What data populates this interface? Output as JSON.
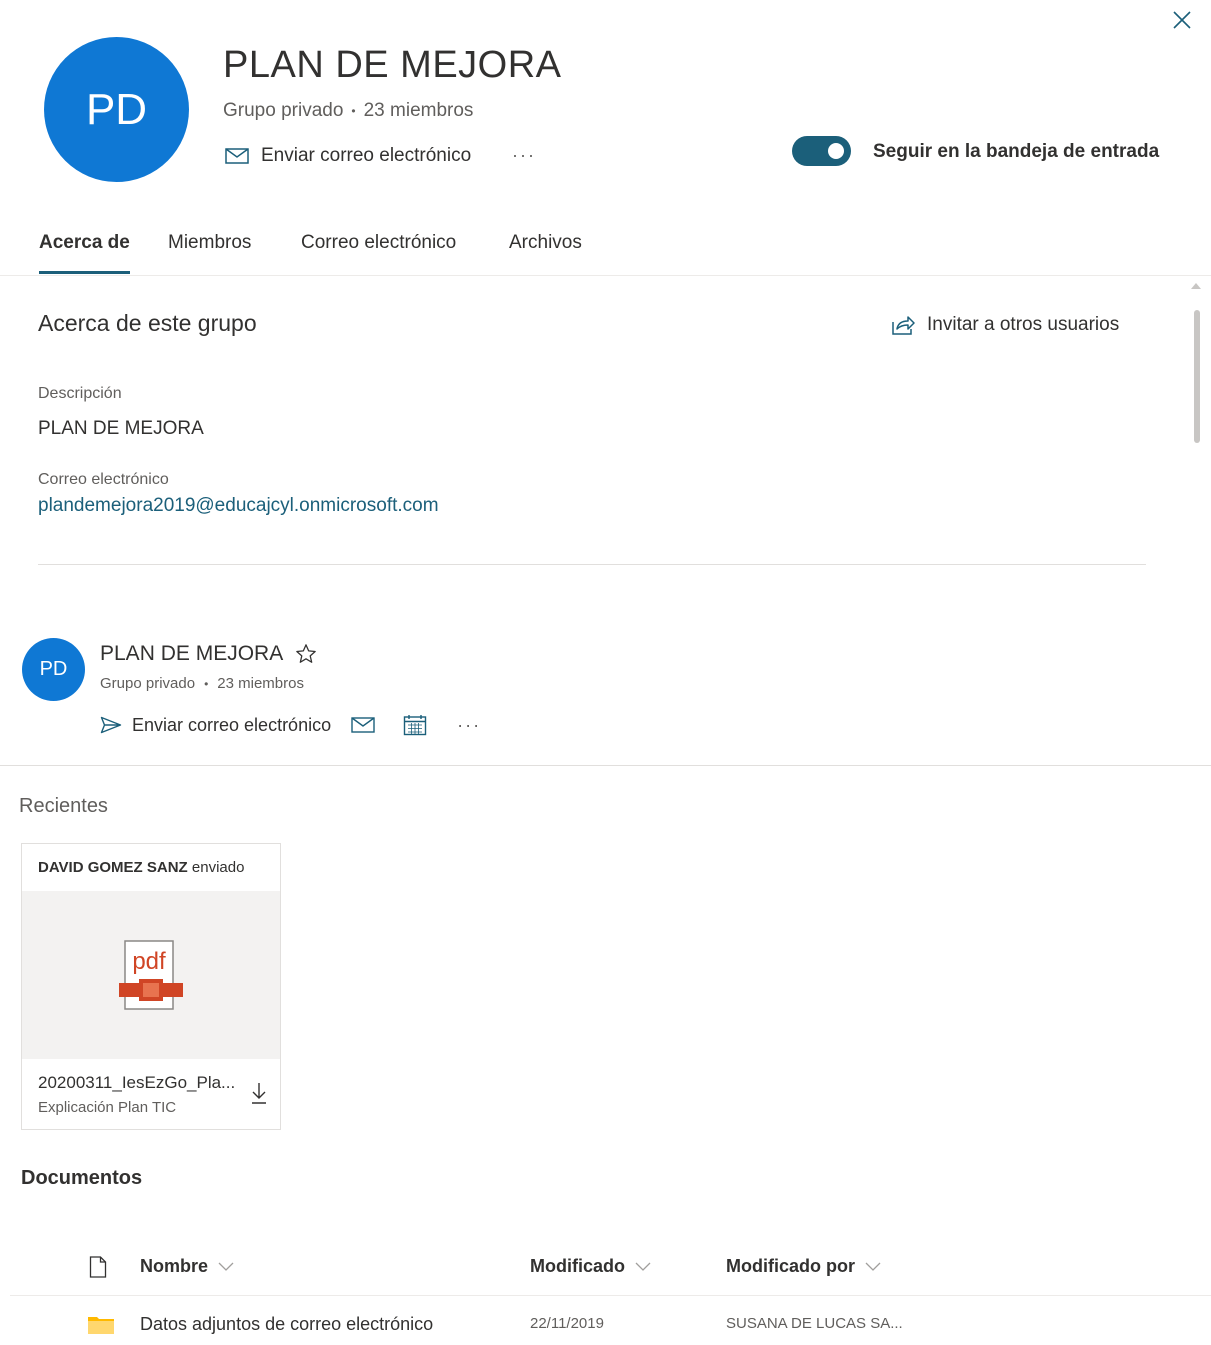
{
  "header": {
    "close_icon": "close-icon",
    "avatar_initials": "PD",
    "avatar_color": "#0f78d4",
    "title": "PLAN DE MEJORA",
    "type": "Grupo privado",
    "separator": "•",
    "members": "23 miembros",
    "send_email": "Enviar correo electrónico",
    "more": "···",
    "follow_label": "Seguir en la bandeja de entrada",
    "follow_on": true,
    "accent": "#1b5f7a"
  },
  "tabs": [
    {
      "label": "Acerca de",
      "active": true
    },
    {
      "label": "Miembros",
      "active": false
    },
    {
      "label": "Correo electrónico",
      "active": false
    },
    {
      "label": "Archivos",
      "active": false
    }
  ],
  "about": {
    "title": "Acerca de este grupo",
    "invite": "Invitar a otros usuarios",
    "description_label": "Descripción",
    "description": "PLAN DE MEJORA",
    "email_label": "Correo electrónico",
    "email": "plandemejora2019@educajcyl.onmicrosoft.com"
  },
  "group_card": {
    "initials": "PD",
    "title": "PLAN DE MEJORA",
    "type": "Grupo privado",
    "separator": "•",
    "members": "23 miembros",
    "send_email": "Enviar correo electrónico",
    "more": "···"
  },
  "recent": {
    "title": "Recientes",
    "card": {
      "author": "DAVID GOMEZ SANZ",
      "action": "enviado",
      "file_name": "20200311_IesEzGo_Pla...",
      "subtitle": "Explicación Plan TIC",
      "file_type_label": "pdf"
    }
  },
  "documents": {
    "title": "Documentos",
    "columns": {
      "name": "Nombre",
      "modified": "Modificado",
      "modified_by": "Modificado por"
    },
    "rows": [
      {
        "name": "Datos adjuntos de correo electrónico",
        "modified": "22/11/2019",
        "modified_by": "SUSANA DE LUCAS SA..."
      }
    ]
  }
}
